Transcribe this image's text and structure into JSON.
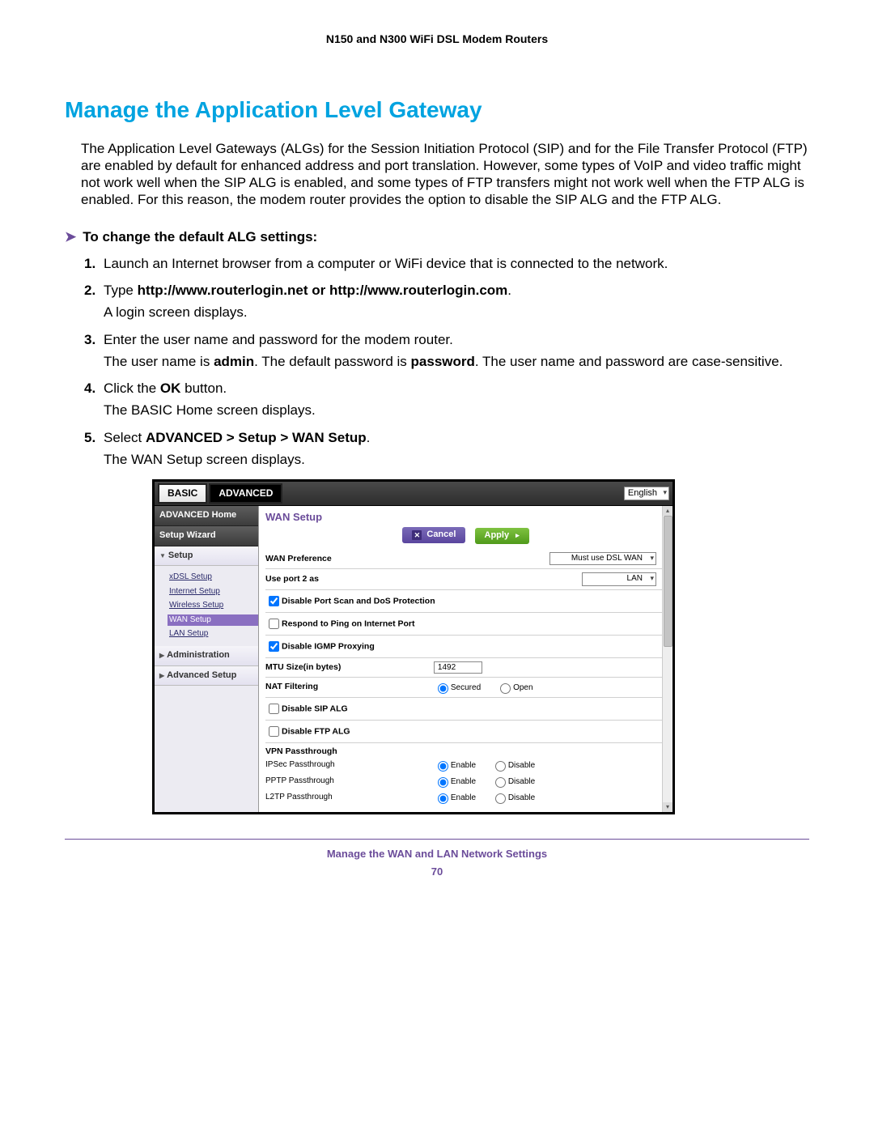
{
  "header": "N150 and N300 WiFi DSL Modem Routers",
  "title": "Manage the Application Level Gateway",
  "intro": "The Application Level Gateways (ALGs) for the Session Initiation Protocol (SIP) and for the File Transfer Protocol (FTP) are enabled by default for enhanced address and port translation. However, some types of VoIP and video traffic might not work well when the SIP ALG is enabled, and some types of FTP transfers might not work well when the FTP ALG is enabled. For this reason, the modem router provides the option to disable the SIP ALG and the FTP ALG.",
  "procedure_heading": "To change the default ALG settings:",
  "steps": {
    "s1": "Launch an Internet browser from a computer or WiFi device that is connected to the network.",
    "s2_pre": "Type ",
    "s2_bold": "http://www.routerlogin.net or http://www.routerlogin.com",
    "s2_post": ".",
    "s2_p": "A login screen displays.",
    "s3": "Enter the user name and password for the modem router.",
    "s3_p_a": "The user name is ",
    "s3_admin": "admin",
    "s3_p_b": ". The default password is ",
    "s3_pwd": "password",
    "s3_p_c": ". The user name and password are case-sensitive.",
    "s4_a": "Click the ",
    "s4_ok": "OK",
    "s4_b": " button.",
    "s4_p": "The BASIC Home screen displays.",
    "s5_a": "Select ",
    "s5_nav": "ADVANCED > Setup > WAN Setup",
    "s5_b": ".",
    "s5_p": "The WAN Setup screen displays."
  },
  "ui": {
    "tabs": {
      "basic": "BASIC",
      "advanced": "ADVANCED"
    },
    "language": "English",
    "sidebar": {
      "adv_home": "ADVANCED Home",
      "setup_wizard": "Setup Wizard",
      "setup": "Setup",
      "sub": {
        "xdsl": "xDSL Setup",
        "internet": "Internet Setup",
        "wireless": "Wireless Setup",
        "wan": "WAN Setup",
        "lan": "LAN Setup"
      },
      "admin": "Administration",
      "adv_setup": "Advanced Setup"
    },
    "page_title": "WAN Setup",
    "buttons": {
      "cancel": "Cancel",
      "apply": "Apply"
    },
    "rows": {
      "wan_pref": "WAN Preference",
      "wan_pref_val": "Must use DSL WAN",
      "port2": "Use port 2 as",
      "port2_val": "LAN",
      "disable_scan": "Disable Port Scan and DoS Protection",
      "respond_ping": "Respond to Ping on Internet Port",
      "disable_igmp": "Disable IGMP Proxying",
      "mtu": "MTU Size(in bytes)",
      "mtu_val": "1492",
      "nat": "NAT Filtering",
      "secured": "Secured",
      "open": "Open",
      "disable_sip": "Disable SIP ALG",
      "disable_ftp": "Disable FTP ALG",
      "vpn": "VPN Passthrough",
      "ipsec": "IPSec Passthrough",
      "pptp": "PPTP Passthrough",
      "l2tp": "L2TP Passthrough",
      "enable": "Enable",
      "disable": "Disable"
    }
  },
  "footer": {
    "text": "Manage the WAN and LAN Network Settings",
    "page": "70"
  }
}
